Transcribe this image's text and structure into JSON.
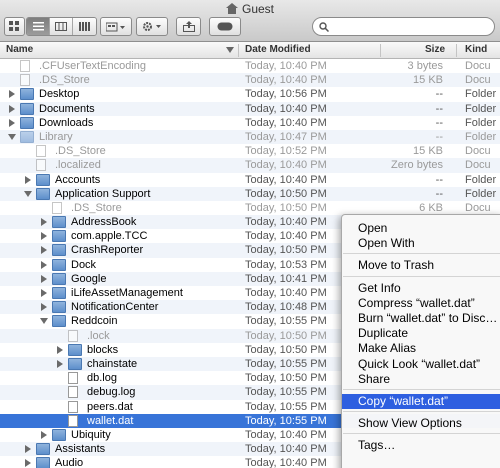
{
  "window": {
    "title": "Guest"
  },
  "toolbar": {
    "search_placeholder": ""
  },
  "columns": {
    "name": "Name",
    "date": "Date Modified",
    "size": "Size",
    "kind": "Kind"
  },
  "rows": [
    {
      "indent": 0,
      "disclosure": "none",
      "icon": "doc",
      "name": ".CFUserTextEncoding",
      "date": "Today, 10:40 PM",
      "size": "3 bytes",
      "kind": "Docu",
      "dim": true
    },
    {
      "indent": 0,
      "disclosure": "none",
      "icon": "doc",
      "name": ".DS_Store",
      "date": "Today, 10:40 PM",
      "size": "15 KB",
      "kind": "Docu",
      "dim": true
    },
    {
      "indent": 0,
      "disclosure": "closed",
      "icon": "folder",
      "name": "Desktop",
      "date": "Today, 10:56 PM",
      "size": "--",
      "kind": "Folder"
    },
    {
      "indent": 0,
      "disclosure": "closed",
      "icon": "folder",
      "name": "Documents",
      "date": "Today, 10:40 PM",
      "size": "--",
      "kind": "Folder"
    },
    {
      "indent": 0,
      "disclosure": "closed",
      "icon": "folder",
      "name": "Downloads",
      "date": "Today, 10:40 PM",
      "size": "--",
      "kind": "Folder"
    },
    {
      "indent": 0,
      "disclosure": "open",
      "icon": "folder",
      "name": "Library",
      "date": "Today, 10:47 PM",
      "size": "--",
      "kind": "Folder",
      "dim": true
    },
    {
      "indent": 1,
      "disclosure": "none",
      "icon": "doc",
      "name": ".DS_Store",
      "date": "Today, 10:52 PM",
      "size": "15 KB",
      "kind": "Docu",
      "dim": true
    },
    {
      "indent": 1,
      "disclosure": "none",
      "icon": "doc",
      "name": ".localized",
      "date": "Today, 10:40 PM",
      "size": "Zero bytes",
      "kind": "Docu",
      "dim": true
    },
    {
      "indent": 1,
      "disclosure": "closed",
      "icon": "folder",
      "name": "Accounts",
      "date": "Today, 10:40 PM",
      "size": "--",
      "kind": "Folder"
    },
    {
      "indent": 1,
      "disclosure": "open",
      "icon": "folder",
      "name": "Application Support",
      "date": "Today, 10:50 PM",
      "size": "--",
      "kind": "Folder"
    },
    {
      "indent": 2,
      "disclosure": "none",
      "icon": "doc",
      "name": ".DS_Store",
      "date": "Today, 10:50 PM",
      "size": "6 KB",
      "kind": "Docu",
      "dim": true
    },
    {
      "indent": 2,
      "disclosure": "closed",
      "icon": "folder",
      "name": "AddressBook",
      "date": "Today, 10:40 PM",
      "size": "",
      "kind": ""
    },
    {
      "indent": 2,
      "disclosure": "closed",
      "icon": "folder",
      "name": "com.apple.TCC",
      "date": "Today, 10:40 PM",
      "size": "",
      "kind": ""
    },
    {
      "indent": 2,
      "disclosure": "closed",
      "icon": "folder",
      "name": "CrashReporter",
      "date": "Today, 10:50 PM",
      "size": "",
      "kind": ""
    },
    {
      "indent": 2,
      "disclosure": "closed",
      "icon": "folder",
      "name": "Dock",
      "date": "Today, 10:53 PM",
      "size": "",
      "kind": ""
    },
    {
      "indent": 2,
      "disclosure": "closed",
      "icon": "folder",
      "name": "Google",
      "date": "Today, 10:41 PM",
      "size": "",
      "kind": ""
    },
    {
      "indent": 2,
      "disclosure": "closed",
      "icon": "folder",
      "name": "iLifeAssetManagement",
      "date": "Today, 10:40 PM",
      "size": "",
      "kind": ""
    },
    {
      "indent": 2,
      "disclosure": "closed",
      "icon": "folder",
      "name": "NotificationCenter",
      "date": "Today, 10:48 PM",
      "size": "",
      "kind": ""
    },
    {
      "indent": 2,
      "disclosure": "open",
      "icon": "folder",
      "name": "Reddcoin",
      "date": "Today, 10:55 PM",
      "size": "",
      "kind": ""
    },
    {
      "indent": 3,
      "disclosure": "none",
      "icon": "doc",
      "name": ".lock",
      "date": "Today, 10:50 PM",
      "size": "",
      "kind": "",
      "dim": true
    },
    {
      "indent": 3,
      "disclosure": "closed",
      "icon": "folder",
      "name": "blocks",
      "date": "Today, 10:50 PM",
      "size": "",
      "kind": ""
    },
    {
      "indent": 3,
      "disclosure": "closed",
      "icon": "folder",
      "name": "chainstate",
      "date": "Today, 10:55 PM",
      "size": "",
      "kind": ""
    },
    {
      "indent": 3,
      "disclosure": "none",
      "icon": "doc",
      "name": "db.log",
      "date": "Today, 10:50 PM",
      "size": "",
      "kind": ""
    },
    {
      "indent": 3,
      "disclosure": "none",
      "icon": "doc",
      "name": "debug.log",
      "date": "Today, 10:55 PM",
      "size": "",
      "kind": ""
    },
    {
      "indent": 3,
      "disclosure": "none",
      "icon": "doc",
      "name": "peers.dat",
      "date": "Today, 10:55 PM",
      "size": "",
      "kind": ""
    },
    {
      "indent": 3,
      "disclosure": "none",
      "icon": "doc",
      "name": "wallet.dat",
      "date": "Today, 10:55 PM",
      "size": "",
      "kind": "",
      "selected": true
    },
    {
      "indent": 2,
      "disclosure": "closed",
      "icon": "folder",
      "name": "Ubiquity",
      "date": "Today, 10:40 PM",
      "size": "",
      "kind": ""
    },
    {
      "indent": 1,
      "disclosure": "closed",
      "icon": "folder",
      "name": "Assistants",
      "date": "Today, 10:40 PM",
      "size": "",
      "kind": ""
    },
    {
      "indent": 1,
      "disclosure": "closed",
      "icon": "folder",
      "name": "Audio",
      "date": "Today, 10:40 PM",
      "size": "",
      "kind": ""
    }
  ],
  "context_menu": {
    "items": [
      {
        "label": "Open",
        "group": 0
      },
      {
        "label": "Open With",
        "group": 0
      },
      {
        "label": "Move to Trash",
        "group": 1
      },
      {
        "label": "Get Info",
        "group": 2
      },
      {
        "label": "Compress “wallet.dat”",
        "group": 2
      },
      {
        "label": "Burn “wallet.dat” to Disc…",
        "group": 2
      },
      {
        "label": "Duplicate",
        "group": 2
      },
      {
        "label": "Make Alias",
        "group": 2
      },
      {
        "label": "Quick Look “wallet.dat”",
        "group": 2
      },
      {
        "label": "Share",
        "group": 2
      },
      {
        "label": "Copy “wallet.dat”",
        "group": 3,
        "highlighted": true
      },
      {
        "label": "Show View Options",
        "group": 4
      },
      {
        "label": "Tags…",
        "group": 5
      }
    ]
  },
  "colors": {
    "selection": "#3874d8",
    "menu_highlight": "#2e5fe0",
    "alt_row": "#f0f4fa"
  }
}
